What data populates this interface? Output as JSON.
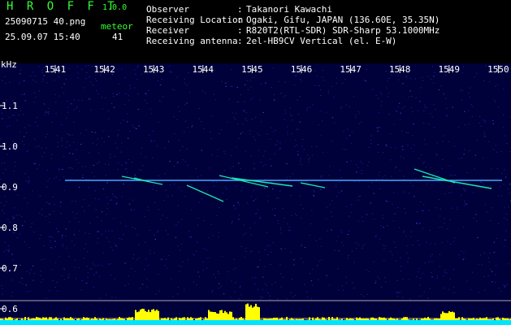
{
  "app": {
    "title": "H R O F F T",
    "version": "1.0.0",
    "filename": "25090715 40.png",
    "datetime": "25.09.07 15:40",
    "meteor_label": "meteor",
    "meteor_count": "41"
  },
  "info": {
    "labels": [
      "Observer",
      "Receiving Location",
      "Receiver",
      "Receiving antenna"
    ],
    "values": [
      "Takanori Kawachi",
      "Ogaki, Gifu, JAPAN (136.60E, 35.35N)",
      "R820T2(RTL-SDR) SDR-Sharp 53.1000MHz",
      "2el-HB9CV Vertical (el. E-W)"
    ]
  },
  "axis": {
    "unit": "kHz",
    "x_ticks": [
      "1541",
      "1542",
      "1543",
      "1544",
      "1545",
      "1546",
      "1547",
      "1548",
      "1549",
      "1550"
    ],
    "y_ticks": [
      "1.1",
      "1.0",
      "0.9",
      "0.8",
      "0.7",
      "0.6"
    ]
  },
  "colors": {
    "background": "#000000",
    "noise": "#1a1a8a",
    "carrier": "#4aa8ff",
    "meteor": "#19e6b4",
    "text_green": "#33ff33",
    "text_white": "#ffffff",
    "power_yellow": "#ffff00",
    "power_cyan": "#00e5ff"
  }
}
